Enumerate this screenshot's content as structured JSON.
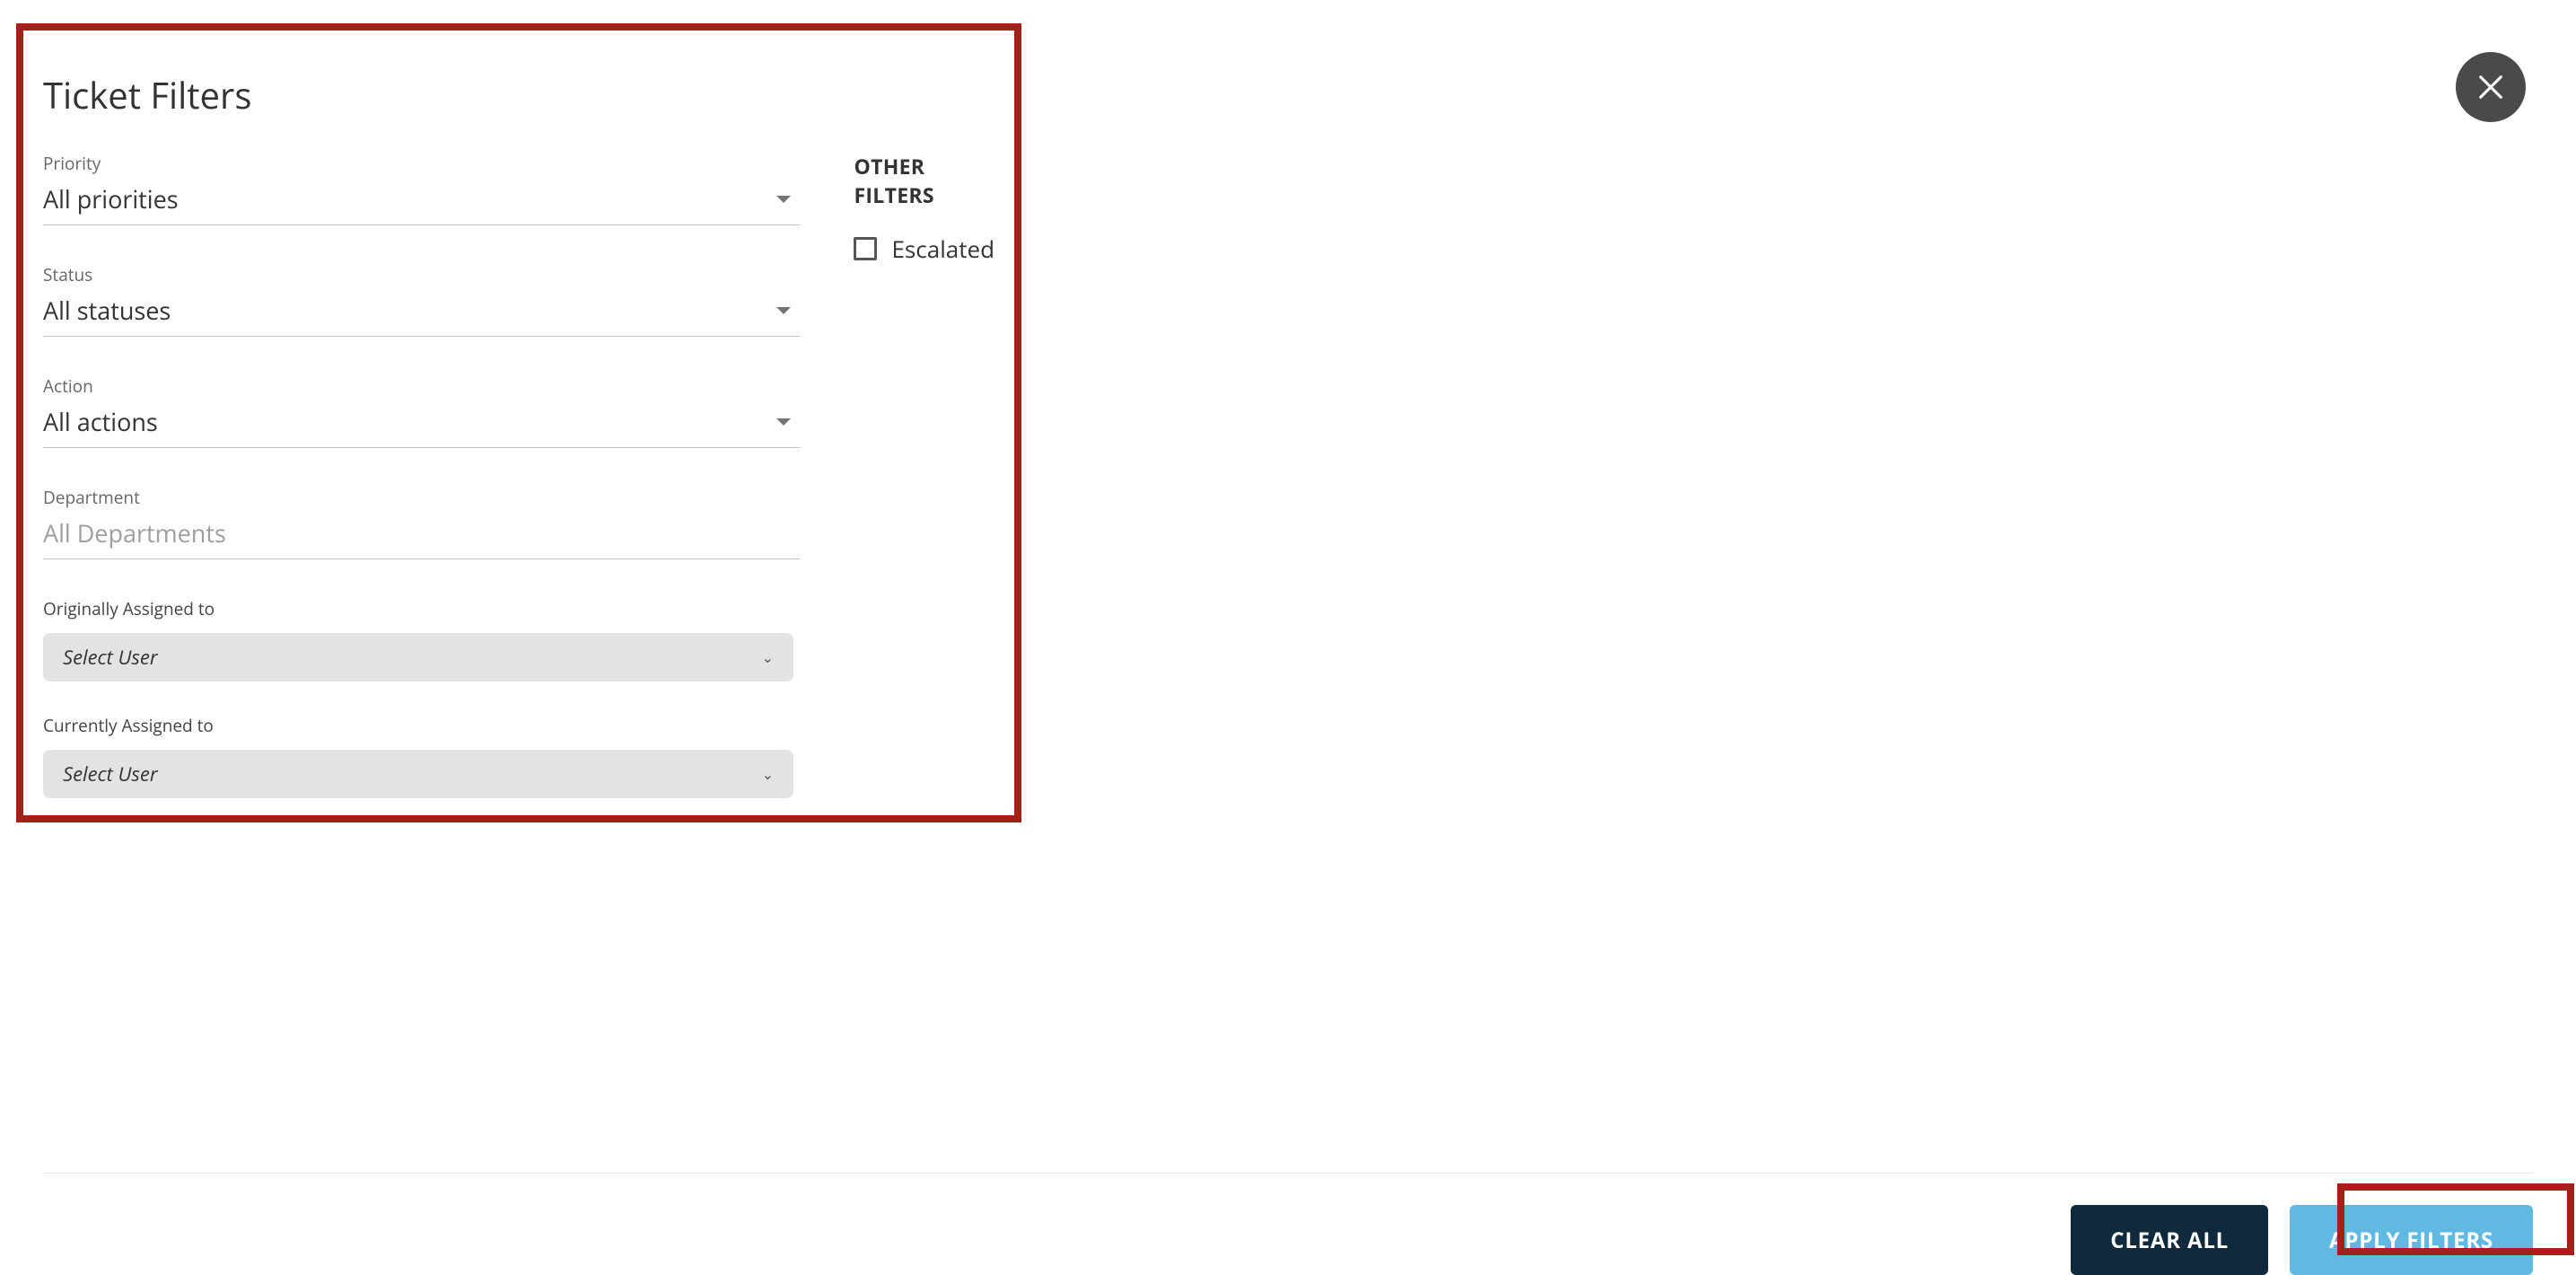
{
  "title": "Ticket Filters",
  "fields": {
    "priority": {
      "label": "Priority",
      "value": "All priorities"
    },
    "status": {
      "label": "Status",
      "value": "All statuses"
    },
    "action": {
      "label": "Action",
      "value": "All actions"
    },
    "department": {
      "label": "Department",
      "placeholder": "All Departments"
    },
    "originally_assigned": {
      "label": "Originally Assigned to",
      "placeholder": "Select User"
    },
    "currently_assigned": {
      "label": "Currently Assigned to",
      "placeholder": "Select User"
    }
  },
  "other_filters": {
    "heading": "OTHER FILTERS",
    "escalated": {
      "label": "Escalated",
      "checked": false
    }
  },
  "buttons": {
    "clear": "CLEAR ALL",
    "apply": "APPLY FILTERS"
  }
}
